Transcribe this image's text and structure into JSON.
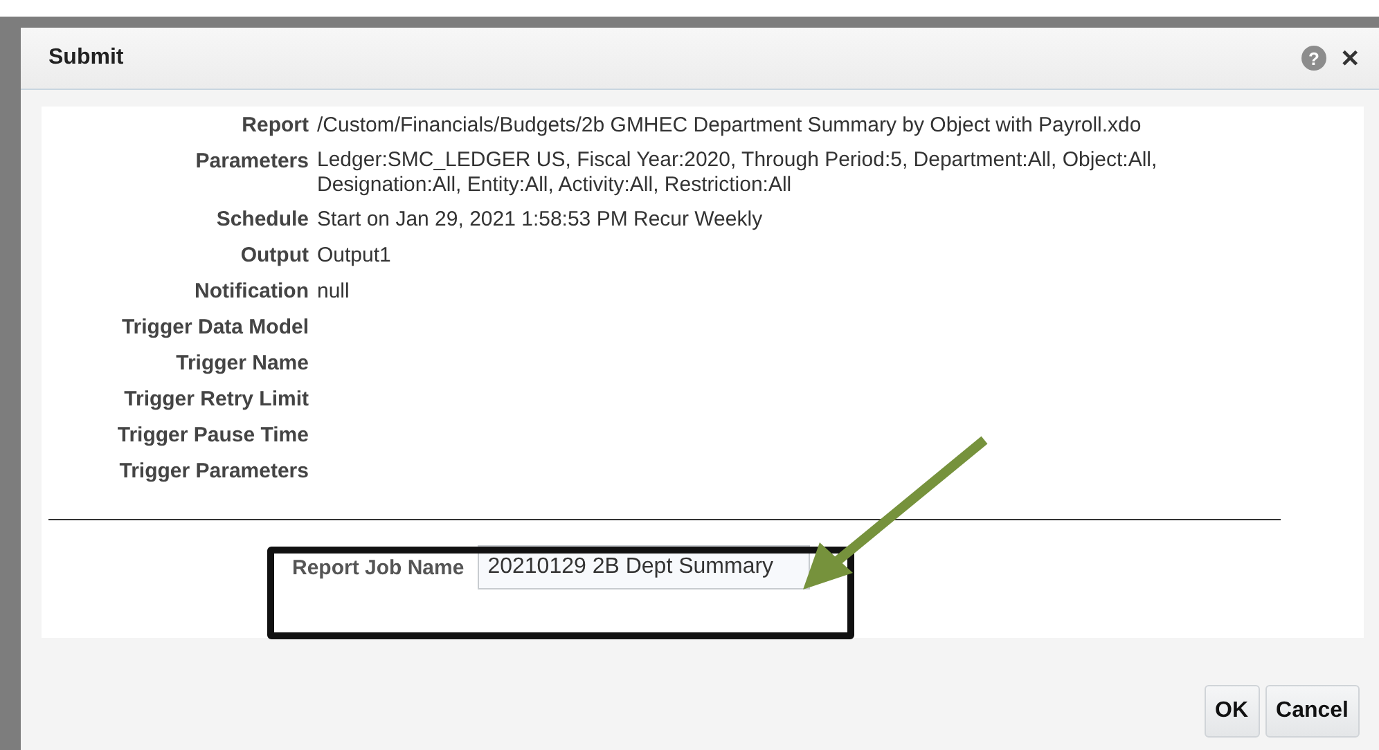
{
  "dialog": {
    "title": "Submit",
    "help_icon": "?",
    "close_icon": "✕"
  },
  "details": [
    {
      "label": "Report",
      "value": "/Custom/Financials/Budgets/2b GMHEC Department Summary by Object with Payroll.xdo"
    },
    {
      "label": "Parameters",
      "value": "Ledger:SMC_LEDGER US, Fiscal Year:2020, Through Period:5, Department:All, Object:All, Designation:All, Entity:All, Activity:All, Restriction:All"
    },
    {
      "label": "Schedule",
      "value": "Start on Jan 29, 2021 1:58:53 PM Recur Weekly"
    },
    {
      "label": "Output",
      "value": "Output1"
    },
    {
      "label": "Notification",
      "value": "null"
    },
    {
      "label": "Trigger Data Model"
    },
    {
      "label": "Trigger Name"
    },
    {
      "label": "Trigger Retry Limit"
    },
    {
      "label": "Trigger Pause Time"
    },
    {
      "label": "Trigger Parameters"
    }
  ],
  "job_name": {
    "label": "Report Job Name",
    "value": "20210129 2B Dept Summary"
  },
  "buttons": [
    "OK",
    "Cancel"
  ]
}
